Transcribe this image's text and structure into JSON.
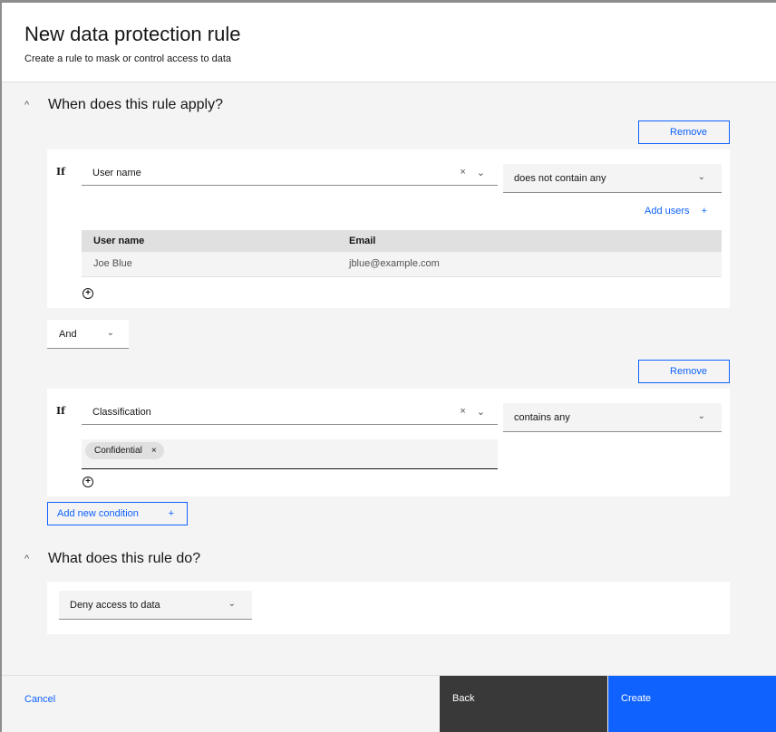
{
  "modal": {
    "title": "New data protection rule",
    "subtitle": "Create a rule to mask or control access to data"
  },
  "section_when": {
    "heading": "When does this rule apply?",
    "conditions": [
      {
        "remove_label": "Remove",
        "if_label": "If",
        "field_value": "User name",
        "operator_value": "does not contain any",
        "add_users_label": "Add users",
        "table": {
          "headers": [
            "User name",
            "Email"
          ],
          "rows": [
            [
              "Joe Blue",
              "jblue@example.com"
            ]
          ]
        }
      },
      {
        "remove_label": "Remove",
        "if_label": "If",
        "field_value": "Classification",
        "operator_value": "contains any",
        "tags": [
          "Confidential"
        ]
      }
    ],
    "conjunction": "And",
    "add_condition_label": "Add new condition"
  },
  "section_what": {
    "heading": "What does this rule do?",
    "action_value": "Deny access to data"
  },
  "footer": {
    "cancel_label": "Cancel",
    "back_label": "Back",
    "create_label": "Create"
  },
  "icons": {
    "chevron_up": "^",
    "chevron_down": "⌄",
    "close": "×",
    "plus": "+"
  },
  "colors": {
    "primary": "#0f62fe",
    "secondary_button": "#393939"
  }
}
